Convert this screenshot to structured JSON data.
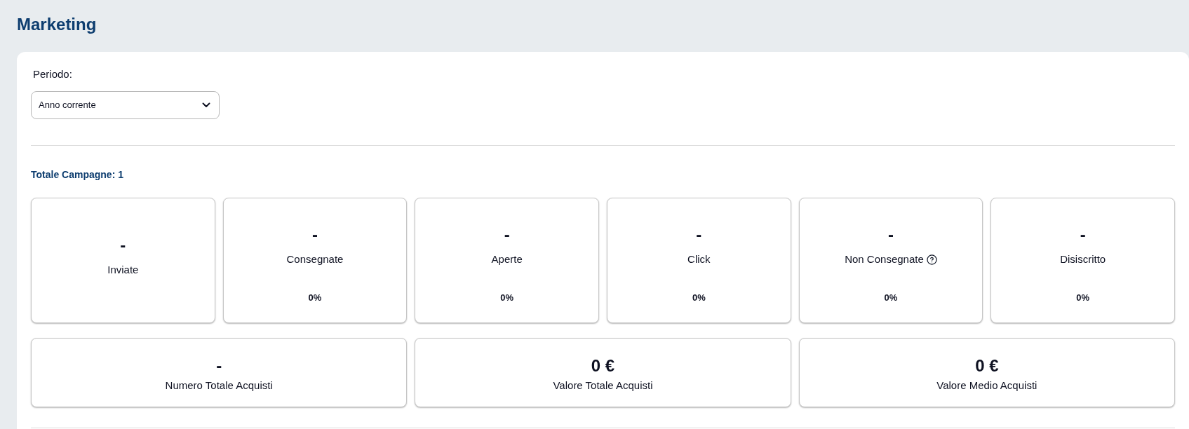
{
  "page": {
    "title": "Marketing"
  },
  "filter": {
    "label": "Periodo:",
    "value": "Anno corrente"
  },
  "total_campaigns": "Totale Campagne: 1",
  "stat_cards": [
    {
      "value": "-",
      "label": "Inviate",
      "help": false
    },
    {
      "value": "-",
      "label": "Consegnate",
      "help": false,
      "percent": "0%"
    },
    {
      "value": "-",
      "label": "Aperte",
      "help": false,
      "percent": "0%"
    },
    {
      "value": "-",
      "label": "Click",
      "help": false,
      "percent": "0%"
    },
    {
      "value": "-",
      "label": "Non Consegnate",
      "help": true,
      "percent": "0%"
    },
    {
      "value": "-",
      "label": "Disiscritto",
      "help": false,
      "percent": "0%"
    }
  ],
  "purchase_cards": [
    {
      "value": "-",
      "label": "Numero Totale Acquisti"
    },
    {
      "value": "0 €",
      "label": "Valore Totale Acquisti"
    },
    {
      "value": "0 €",
      "label": "Valore Medio Acquisti"
    }
  ]
}
